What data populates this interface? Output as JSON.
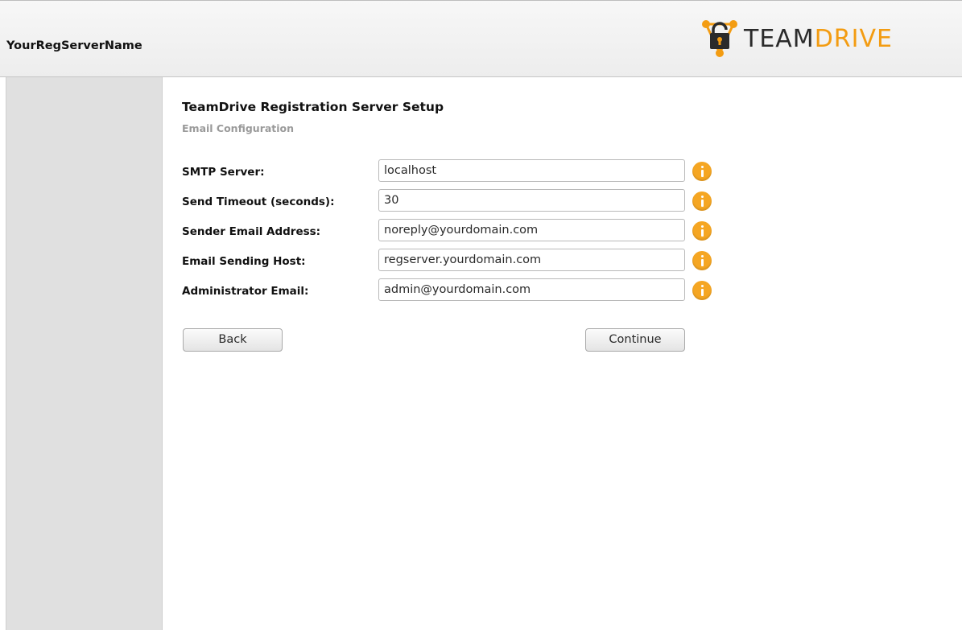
{
  "header": {
    "server_name": "YourRegServerName",
    "logo": {
      "icon": "teamdrive-lock-icon",
      "text_team": "TEAM",
      "text_drive": "DRIVE",
      "accent_color": "#f39c12"
    }
  },
  "main": {
    "title": "TeamDrive Registration Server Setup",
    "subtitle": "Email Configuration",
    "fields": [
      {
        "label": "SMTP Server:",
        "value": "localhost",
        "info_icon": "info-icon"
      },
      {
        "label": "Send Timeout (seconds):",
        "value": "30",
        "info_icon": "info-icon"
      },
      {
        "label": "Sender Email Address:",
        "value": "noreply@yourdomain.com",
        "info_icon": "info-icon"
      },
      {
        "label": "Email Sending Host:",
        "value": "regserver.yourdomain.com",
        "info_icon": "info-icon"
      },
      {
        "label": "Administrator Email:",
        "value": "admin@yourdomain.com",
        "info_icon": "info-icon"
      }
    ],
    "buttons": {
      "back_label": "Back",
      "continue_label": "Continue"
    }
  }
}
